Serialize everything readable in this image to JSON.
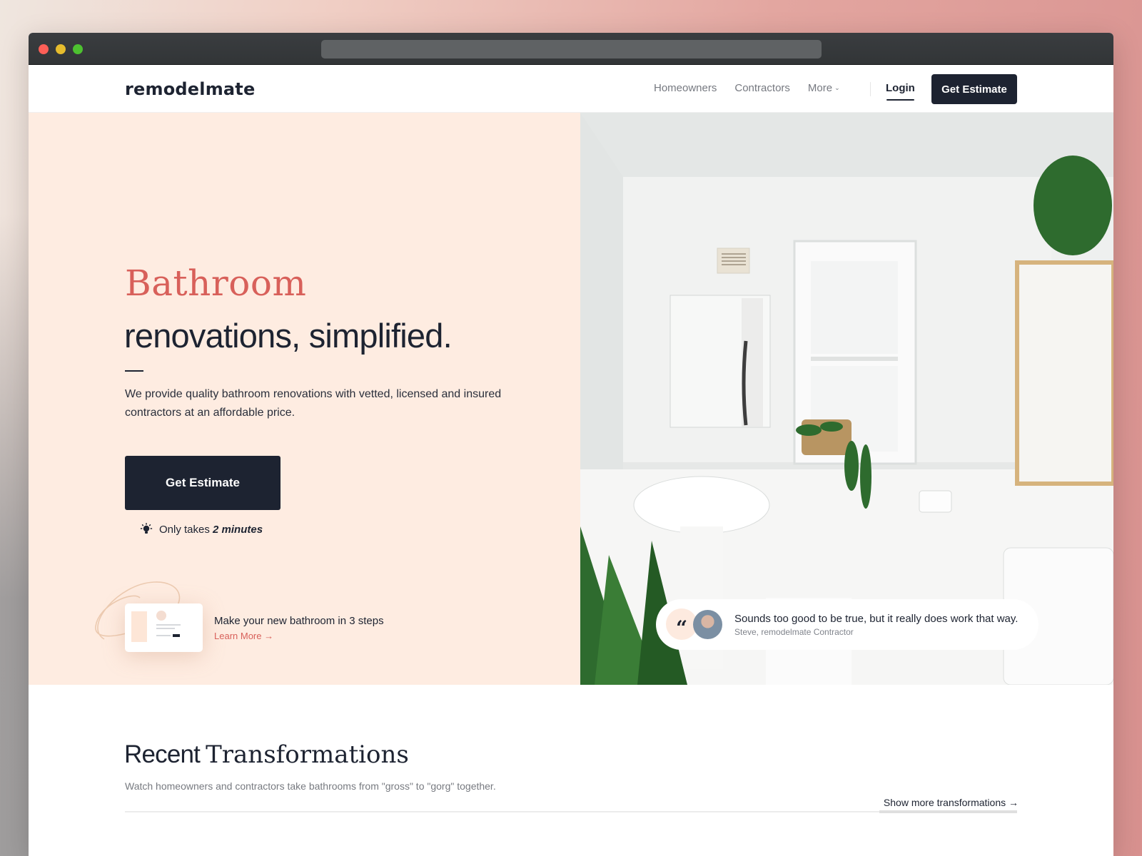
{
  "browser": {
    "address_bar": ""
  },
  "nav": {
    "logo": "remodelmate",
    "links": [
      {
        "label": "Homeowners"
      },
      {
        "label": "Contractors"
      },
      {
        "label": "More",
        "icon": "chevron-down-icon"
      }
    ],
    "login": "Login",
    "cta": "Get Estimate"
  },
  "hero": {
    "title_accent": "Bathroom",
    "title_main": "renovations, simplified.",
    "description": "We provide quality bathroom renovations with vetted, licensed and insured contractors at an affordable price.",
    "cta": "Get Estimate",
    "note_prefix": "Only takes",
    "note_emphasis": "2 minutes",
    "note_icon": "lightbulb-icon",
    "steps": {
      "title": "Make your new bathroom in 3 steps",
      "link": "Learn More →"
    },
    "testimonial": {
      "quote": "Sounds too good to be true, but it really does work that way.",
      "author": "Steve, remodelmate Contractor",
      "icon": "quote-icon"
    }
  },
  "transformations": {
    "title_light": "Recent",
    "title_serif": "Transformations",
    "description": "Watch homeowners and contractors  take bathrooms from \"gross\" to \"gorg\" together.",
    "more_link": "Show more transformations →"
  },
  "colors": {
    "accent": "#d8605a",
    "navy": "#1d2331",
    "hero_bg": "#feece1"
  }
}
